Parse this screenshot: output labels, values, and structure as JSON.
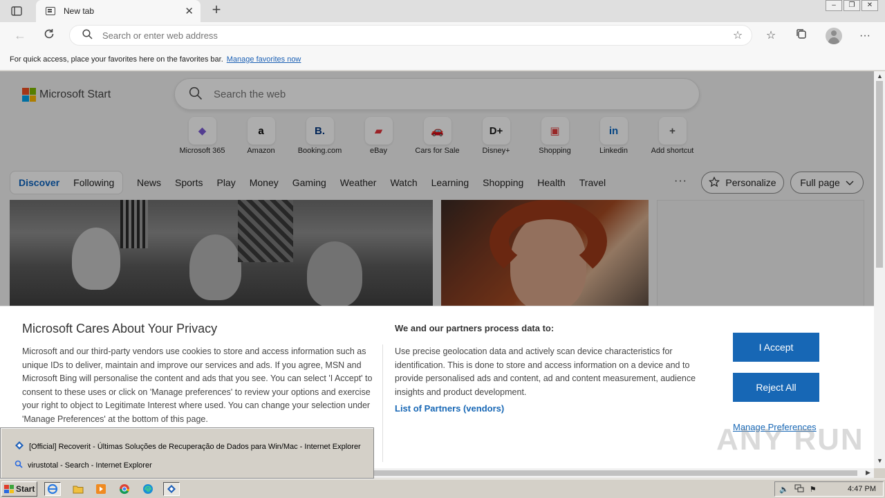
{
  "browser": {
    "tab_title": "New tab",
    "address_placeholder": "Search or enter web address",
    "favbar_text": "For quick access, place your favorites here on the favorites bar.",
    "favbar_link": "Manage favorites now"
  },
  "page": {
    "logo_text": "Microsoft Start",
    "search_placeholder": "Search the web",
    "shortcuts": [
      {
        "label": "Microsoft 365",
        "icon": "microsoft365-icon",
        "color": "#7b5ad6"
      },
      {
        "label": "Amazon",
        "icon": "amazon-icon",
        "color": "#000000"
      },
      {
        "label": "Booking.com",
        "icon": "booking-icon",
        "color": "#003580"
      },
      {
        "label": "eBay",
        "icon": "ebay-icon",
        "color": "#e53238"
      },
      {
        "label": "Cars for Sale",
        "icon": "car-icon",
        "color": "#d13438"
      },
      {
        "label": "Disney+",
        "icon": "disney-icon",
        "color": "#1a1a1a"
      },
      {
        "label": "Shopping",
        "icon": "shopping-bag-icon",
        "color": "#e03a3a"
      },
      {
        "label": "Linkedin",
        "icon": "linkedin-icon",
        "color": "#0a66c2"
      },
      {
        "label": "Add shortcut",
        "icon": "plus-icon",
        "color": "#555555"
      }
    ],
    "feed_tabs": {
      "discover": "Discover",
      "following": "Following"
    },
    "categories": [
      "News",
      "Sports",
      "Play",
      "Money",
      "Gaming",
      "Weather",
      "Watch",
      "Learning",
      "Shopping",
      "Health",
      "Travel"
    ],
    "more": "···",
    "personalize": "Personalize",
    "full_page": "Full page"
  },
  "consent": {
    "title": "Microsoft Cares About Your Privacy",
    "body": "Microsoft and our third-party vendors use cookies to store and access information such as unique IDs to deliver, maintain and improve our services and ads. If you agree, MSN and Microsoft Bing will personalise the content and ads that you see. You can select 'I Accept' to consent to these uses or click on 'Manage preferences' to review your options and exercise your right to object to Legitimate Interest where used.  You can change your selection under 'Manage Preferences' at the bottom of this page.",
    "subtitle": "We and our partners process data to:",
    "body2": "Use precise geolocation data and actively scan device characteristics for identification. This is done to store and access information on a device and to provide personalised ads and content, ad and content measurement, audience insights and product development.",
    "partners_link": "List of Partners (vendors)",
    "accept": "I Accept",
    "reject": "Reject All",
    "manage": "Manage Preferences"
  },
  "watermark": "ANY RUN",
  "taskbar_popup": [
    {
      "label": "[Official] Recoverit - Últimas Soluções de Recuperação de Dados para Win/Mac - Internet Explorer",
      "icon": "recoverit-icon"
    },
    {
      "label": "virustotal - Search - Internet Explorer",
      "icon": "search-icon"
    }
  ],
  "taskbar": {
    "start": "Start",
    "clock": "4:47 PM"
  }
}
